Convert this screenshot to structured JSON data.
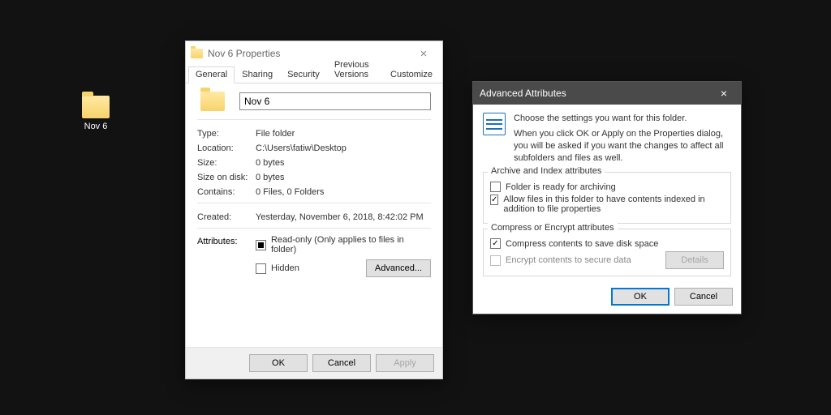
{
  "desktop": {
    "folder_label": "Nov 6"
  },
  "properties": {
    "title": "Nov 6 Properties",
    "tabs": {
      "general": "General",
      "sharing": "Sharing",
      "security": "Security",
      "previous": "Previous Versions",
      "customize": "Customize"
    },
    "name_value": "Nov 6",
    "fields": {
      "type_k": "Type:",
      "type_v": "File folder",
      "location_k": "Location:",
      "location_v": "C:\\Users\\fatiw\\Desktop",
      "size_k": "Size:",
      "size_v": "0 bytes",
      "sod_k": "Size on disk:",
      "sod_v": "0 bytes",
      "contains_k": "Contains:",
      "contains_v": "0 Files, 0 Folders",
      "created_k": "Created:",
      "created_v": "Yesterday, November 6, 2018, 8:42:02 PM",
      "attributes_k": "Attributes:"
    },
    "attrs": {
      "readonly_label": "Read-only (Only applies to files in folder)",
      "hidden_label": "Hidden",
      "advanced_btn": "Advanced..."
    },
    "buttons": {
      "ok": "OK",
      "cancel": "Cancel",
      "apply": "Apply"
    }
  },
  "advanced": {
    "title": "Advanced Attributes",
    "intro_line1": "Choose the settings you want for this folder.",
    "intro_line2": "When you click OK or Apply on the Properties dialog, you will be asked if you want the changes to affect all subfolders and files as well.",
    "group1_legend": "Archive and Index attributes",
    "archive_label": "Folder is ready for archiving",
    "index_label": "Allow files in this folder to have contents indexed in addition to file properties",
    "group2_legend": "Compress or Encrypt attributes",
    "compress_label": "Compress contents to save disk space",
    "encrypt_label": "Encrypt contents to secure data",
    "details_btn": "Details",
    "ok": "OK",
    "cancel": "Cancel"
  }
}
